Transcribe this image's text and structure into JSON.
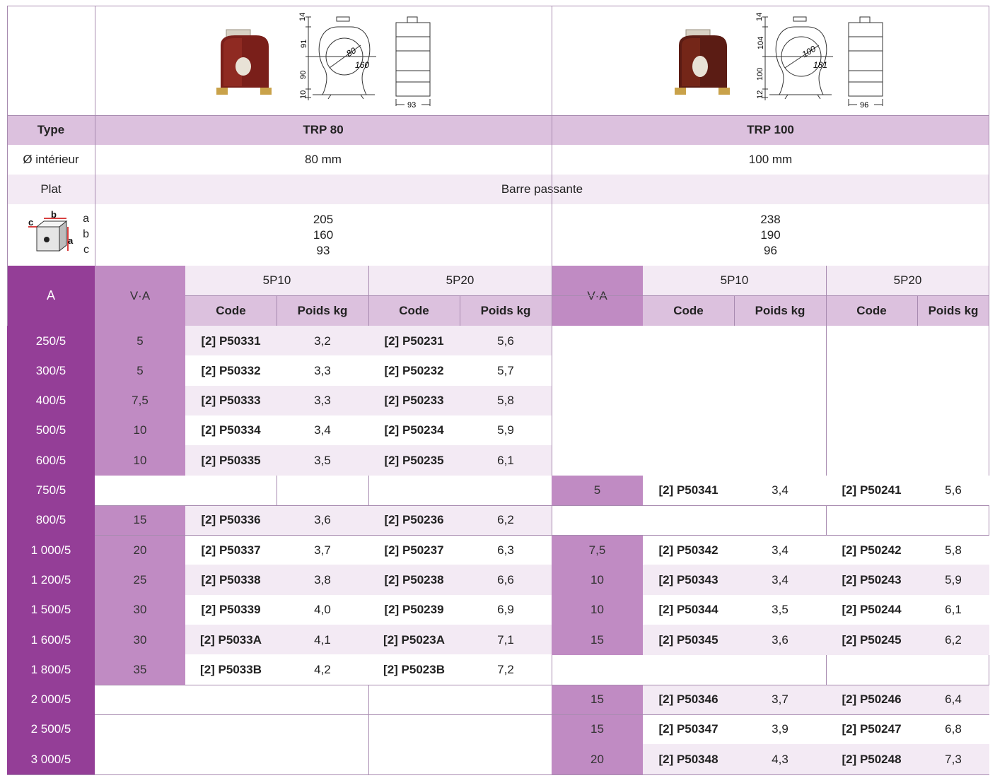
{
  "products": [
    {
      "type": "TRP 80",
      "inner_diameter": "80 mm",
      "dims": {
        "a": "205",
        "b": "160",
        "c": "93"
      },
      "drawing": {
        "d_in": "80",
        "d_out": "160",
        "top": "14",
        "upper": "91",
        "lower": "90",
        "base": "10",
        "depth": "93"
      }
    },
    {
      "type": "TRP 100",
      "inner_diameter": "100 mm",
      "dims": {
        "a": "238",
        "b": "190",
        "c": "96"
      },
      "drawing": {
        "d_in": "100",
        "d_out": "181",
        "top": "14",
        "upper": "104",
        "lower": "100",
        "base": "12",
        "depth": "96"
      }
    }
  ],
  "labels": {
    "type": "Type",
    "inner_diameter": "Ø intérieur",
    "plat": "Plat",
    "plat_value": "Barre passante",
    "dim_a": "a",
    "dim_b": "b",
    "dim_c": "c",
    "col_a": "A",
    "col_va": "V·A",
    "class1": "5P10",
    "class2": "5P20",
    "code": "Code",
    "weight": "Poids kg"
  },
  "rows": [
    {
      "a": "250/5",
      "p1": {
        "va": "5",
        "c1": "[2] P50331",
        "w1": "3,2",
        "c2": "[2] P50231",
        "w2": "5,6"
      },
      "p2": null
    },
    {
      "a": "300/5",
      "p1": {
        "va": "5",
        "c1": "[2] P50332",
        "w1": "3,3",
        "c2": "[2] P50232",
        "w2": "5,7"
      },
      "p2": null
    },
    {
      "a": "400/5",
      "p1": {
        "va": "7,5",
        "c1": "[2] P50333",
        "w1": "3,3",
        "c2": "[2] P50233",
        "w2": "5,8"
      },
      "p2": null
    },
    {
      "a": "500/5",
      "p1": {
        "va": "10",
        "c1": "[2] P50334",
        "w1": "3,4",
        "c2": "[2] P50234",
        "w2": "5,9"
      },
      "p2": null
    },
    {
      "a": "600/5",
      "p1": {
        "va": "10",
        "c1": "[2] P50335",
        "w1": "3,5",
        "c2": "[2] P50235",
        "w2": "6,1"
      },
      "p2": null
    },
    {
      "a": "750/5",
      "p1": null,
      "p2": {
        "va": "5",
        "c1": "[2] P50341",
        "w1": "3,4",
        "c2": "[2] P50241",
        "w2": "5,6"
      }
    },
    {
      "a": "800/5",
      "p1": {
        "va": "15",
        "c1": "[2] P50336",
        "w1": "3,6",
        "c2": "[2] P50236",
        "w2": "6,2"
      },
      "p2": null
    },
    {
      "a": "1 000/5",
      "p1": {
        "va": "20",
        "c1": "[2] P50337",
        "w1": "3,7",
        "c2": "[2] P50237",
        "w2": "6,3"
      },
      "p2": {
        "va": "7,5",
        "c1": "[2] P50342",
        "w1": "3,4",
        "c2": "[2] P50242",
        "w2": "5,8"
      }
    },
    {
      "a": "1 200/5",
      "p1": {
        "va": "25",
        "c1": "[2] P50338",
        "w1": "3,8",
        "c2": "[2] P50238",
        "w2": "6,6"
      },
      "p2": {
        "va": "10",
        "c1": "[2] P50343",
        "w1": "3,4",
        "c2": "[2] P50243",
        "w2": "5,9"
      }
    },
    {
      "a": "1 500/5",
      "p1": {
        "va": "30",
        "c1": "[2] P50339",
        "w1": "4,0",
        "c2": "[2] P50239",
        "w2": "6,9"
      },
      "p2": {
        "va": "10",
        "c1": "[2] P50344",
        "w1": "3,5",
        "c2": "[2] P50244",
        "w2": "6,1"
      }
    },
    {
      "a": "1 600/5",
      "p1": {
        "va": "30",
        "c1": "[2] P5033A",
        "w1": "4,1",
        "c2": "[2] P5023A",
        "w2": "7,1"
      },
      "p2": {
        "va": "15",
        "c1": "[2] P50345",
        "w1": "3,6",
        "c2": "[2] P50245",
        "w2": "6,2"
      }
    },
    {
      "a": "1 800/5",
      "p1": {
        "va": "35",
        "c1": "[2] P5033B",
        "w1": "4,2",
        "c2": "[2] P5023B",
        "w2": "7,2"
      },
      "p2": null
    },
    {
      "a": "2 000/5",
      "p1": null,
      "p2": {
        "va": "15",
        "c1": "[2] P50346",
        "w1": "3,7",
        "c2": "[2] P50246",
        "w2": "6,4"
      }
    },
    {
      "a": "2 500/5",
      "p1": null,
      "p2": {
        "va": "15",
        "c1": "[2] P50347",
        "w1": "3,9",
        "c2": "[2] P50247",
        "w2": "6,8"
      }
    },
    {
      "a": "3 000/5",
      "p1": null,
      "p2": {
        "va": "20",
        "c1": "[2] P50348",
        "w1": "4,3",
        "c2": "[2] P50248",
        "w2": "7,3"
      }
    }
  ]
}
